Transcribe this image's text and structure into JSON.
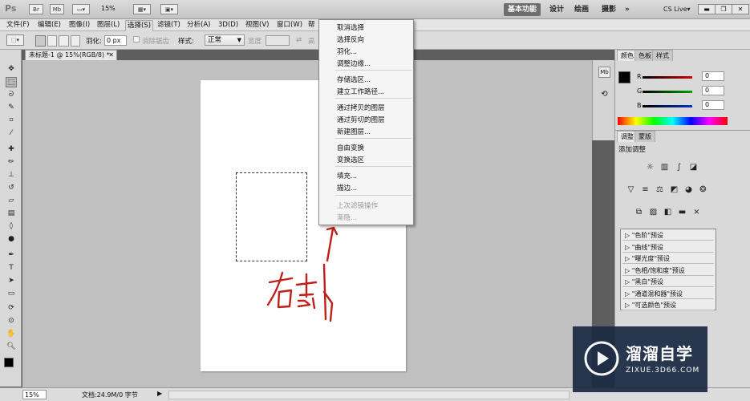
{
  "app": {
    "logo": "Ps",
    "zoom": "15%"
  },
  "workspaces": [
    {
      "label": "基本功能",
      "active": true
    },
    {
      "label": "设计",
      "active": false
    },
    {
      "label": "绘画",
      "active": false
    },
    {
      "label": "摄影",
      "active": false
    },
    {
      "label": "»",
      "active": false
    },
    {
      "label": "CS Live▾",
      "active": false
    }
  ],
  "menubar": [
    "文件(F)",
    "编辑(E)",
    "图像(I)",
    "图层(L)",
    "选择(S)",
    "滤镜(T)",
    "分析(A)",
    "3D(D)",
    "视图(V)",
    "窗口(W)",
    "帮"
  ],
  "options": {
    "feather_label": "羽化:",
    "feather_value": "0 px",
    "antialias_label": "消除锯齿",
    "style_label": "样式:",
    "style_value": "正常",
    "width_label": "宽度",
    "height_label": "高"
  },
  "document": {
    "tab_title": "未标题-1 @ 15%(RGB/8) *"
  },
  "context_menu": [
    {
      "label": "取消选择",
      "disabled": false
    },
    {
      "label": "选择反向",
      "disabled": false
    },
    {
      "label": "羽化...",
      "disabled": false
    },
    {
      "label": "调整边缘...",
      "disabled": false
    },
    {
      "label": "存储选区...",
      "disabled": false
    },
    {
      "label": "建立工作路径...",
      "disabled": false
    },
    {
      "label": "通过拷贝的图层",
      "disabled": false
    },
    {
      "label": "通过剪切的图层",
      "disabled": false
    },
    {
      "label": "新建图层...",
      "disabled": false
    },
    {
      "label": "自由变换",
      "disabled": false
    },
    {
      "label": "变换选区",
      "disabled": false
    },
    {
      "label": "填充...",
      "disabled": false
    },
    {
      "label": "描边...",
      "disabled": false
    },
    {
      "label": "上次滤镜操作",
      "disabled": true
    },
    {
      "label": "渐隐...",
      "disabled": true
    }
  ],
  "annotation": {
    "text": "右击",
    "color": "#c0201a"
  },
  "color_panel": {
    "tabs": [
      "颜色",
      "色板",
      "样式"
    ],
    "channels": [
      {
        "name": "R",
        "value": "0",
        "color": "#d40000"
      },
      {
        "name": "G",
        "value": "0",
        "color": "#00a000"
      },
      {
        "name": "B",
        "value": "0",
        "color": "#0030d0"
      }
    ]
  },
  "adjust_panel": {
    "tabs": [
      "调整",
      "蒙版"
    ],
    "title": "添加调整",
    "presets": [
      "\"色阶\"预设",
      "\"曲线\"预设",
      "\"曝光度\"预设",
      "\"色相/饱和度\"预设",
      "\"黑白\"预设",
      "\"通道混和器\"预设",
      "\"可选颜色\"预设"
    ]
  },
  "status": {
    "zoom": "15%",
    "doc_info": "文档:24.9M/0 字节"
  },
  "watermark": {
    "brand": "溜溜自学",
    "url": "ZIXUE.3D66.COM"
  }
}
